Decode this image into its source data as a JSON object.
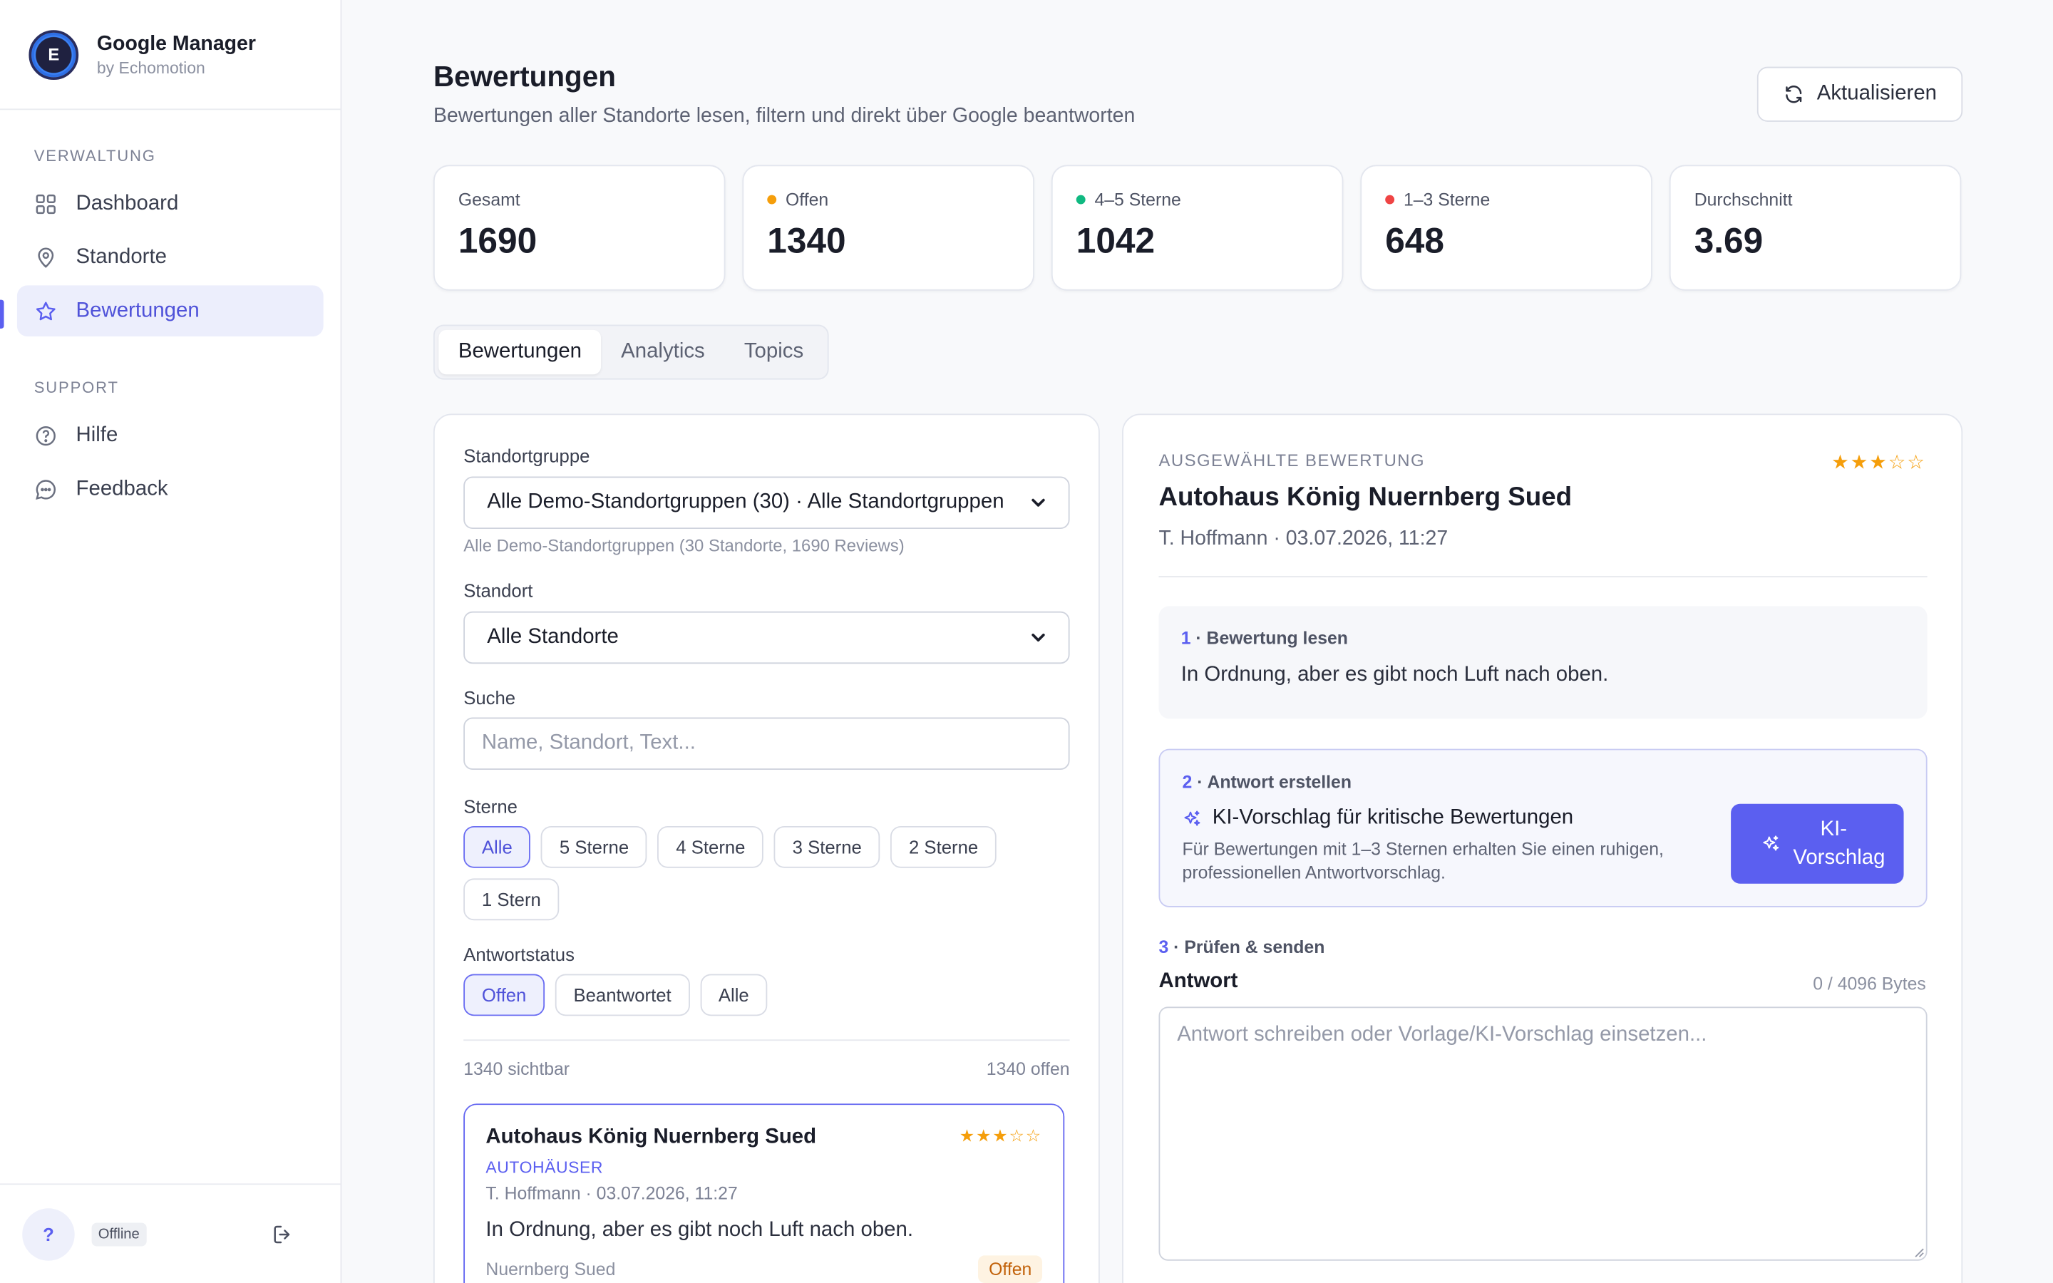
{
  "brand": {
    "title": "Google Manager",
    "subtitle": "by Echomotion",
    "logo_letter": "E"
  },
  "sidebar": {
    "sections": [
      {
        "heading": "VERWALTUNG",
        "items": [
          {
            "label": "Dashboard",
            "icon": "grid-icon"
          },
          {
            "label": "Standorte",
            "icon": "map-pin-icon"
          },
          {
            "label": "Bewertungen",
            "icon": "star-icon",
            "active": true
          }
        ]
      },
      {
        "heading": "SUPPORT",
        "items": [
          {
            "label": "Hilfe",
            "icon": "help-circle-icon"
          },
          {
            "label": "Feedback",
            "icon": "message-icon"
          }
        ]
      }
    ],
    "footer": {
      "help_label": "?",
      "status": "Offline"
    }
  },
  "header": {
    "title": "Bewertungen",
    "subtitle": "Bewertungen aller Standorte lesen, filtern und direkt über Google beantworten",
    "refresh_label": "Aktualisieren"
  },
  "stats": [
    {
      "label": "Gesamt",
      "value": "1690",
      "dot": null
    },
    {
      "label": "Offen",
      "value": "1340",
      "dot": "#f59e0b"
    },
    {
      "label": "4–5 Sterne",
      "value": "1042",
      "dot": "#10b981"
    },
    {
      "label": "1–3 Sterne",
      "value": "648",
      "dot": "#ef4444"
    },
    {
      "label": "Durchschnitt",
      "value": "3.69",
      "dot": null
    }
  ],
  "tabs": [
    "Bewertungen",
    "Analytics",
    "Topics"
  ],
  "filters": {
    "group_label": "Standortgruppe",
    "group_value": "Alle Demo-Standortgruppen (30) · Alle Standortgruppen",
    "group_helper": "Alle Demo-Standortgruppen (30 Standorte, 1690 Reviews)",
    "location_label": "Standort",
    "location_value": "Alle Standorte",
    "search_label": "Suche",
    "search_placeholder": "Name, Standort, Text...",
    "stars_label": "Sterne",
    "star_chips": [
      "Alle",
      "5 Sterne",
      "4 Sterne",
      "3 Sterne",
      "2 Sterne",
      "1 Stern"
    ],
    "status_label": "Antwortstatus",
    "status_chips": [
      "Offen",
      "Beantwortet",
      "Alle"
    ],
    "visible_count": "1340 sichtbar",
    "open_count": "1340 offen"
  },
  "review_list": [
    {
      "title": "Autohaus König Nuernberg Sued",
      "category": "AUTOHÄUSER",
      "meta": "T. Hoffmann · 03.07.2026, 11:27",
      "text": "In Ordnung, aber es gibt noch Luft nach oben.",
      "location": "Nuernberg Sued",
      "status": "Offen",
      "stars": "★★★☆☆",
      "rating": 3
    }
  ],
  "detail": {
    "overline": "AUSGEWÄHLTE BEWERTUNG",
    "stars": "★★★☆☆",
    "rating": 3,
    "title": "Autohaus König Nuernberg Sued",
    "meta": "T. Hoffmann · 03.07.2026, 11:27",
    "step1_num": "1",
    "step1_label": " · Bewertung lesen",
    "step1_text": "In Ordnung, aber es gibt noch Luft nach oben.",
    "step2_num": "2",
    "step2_label": " · Antwort erstellen",
    "ai_title": "KI-Vorschlag für kritische Bewertungen",
    "ai_desc": "Für Bewertungen mit 1–3 Sternen erhalten Sie einen ruhigen, professionellen Antwortvorschlag.",
    "ai_button": "KI-Vorschlag",
    "step3_num": "3",
    "step3_label": " · Prüfen & senden",
    "answer_label": "Antwort",
    "bytes": "0 / 4096 Bytes",
    "answer_placeholder": "Antwort schreiben oder Vorlage/KI-Vorschlag einsetzen..."
  },
  "colors": {
    "accent": "#5b5ff0",
    "star": "#f59e0b",
    "open_status": "#c2620a"
  }
}
